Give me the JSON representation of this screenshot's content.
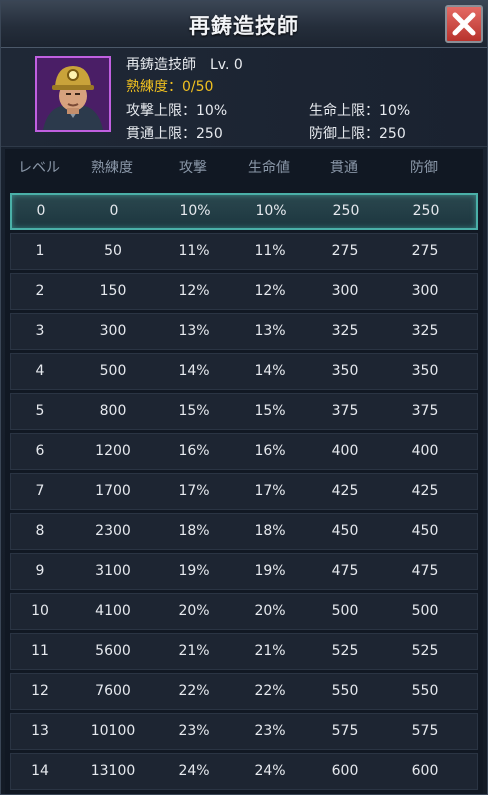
{
  "title": "再鋳造技師",
  "close_icon": "close-icon",
  "character": {
    "name": "再鋳造技師",
    "level": "Lv. 0",
    "proficiency": "熟練度：0/50",
    "stats": {
      "attack_cap": "攻撃上限：10%",
      "hp_cap": "生命上限：10%",
      "pierce_cap": "貫通上限：250",
      "defense_cap": "防御上限：250"
    },
    "avatar_icon": "miner-helmet-portrait-icon"
  },
  "table": {
    "headers": [
      "レベル",
      "熟練度",
      "攻撃",
      "生命値",
      "貫通",
      "防御"
    ],
    "rows": [
      [
        "0",
        "0",
        "10%",
        "10%",
        "250",
        "250"
      ],
      [
        "1",
        "50",
        "11%",
        "11%",
        "275",
        "275"
      ],
      [
        "2",
        "150",
        "12%",
        "12%",
        "300",
        "300"
      ],
      [
        "3",
        "300",
        "13%",
        "13%",
        "325",
        "325"
      ],
      [
        "4",
        "500",
        "14%",
        "14%",
        "350",
        "350"
      ],
      [
        "5",
        "800",
        "15%",
        "15%",
        "375",
        "375"
      ],
      [
        "6",
        "1200",
        "16%",
        "16%",
        "400",
        "400"
      ],
      [
        "7",
        "1700",
        "17%",
        "17%",
        "425",
        "425"
      ],
      [
        "8",
        "2300",
        "18%",
        "18%",
        "450",
        "450"
      ],
      [
        "9",
        "3100",
        "19%",
        "19%",
        "475",
        "475"
      ],
      [
        "10",
        "4100",
        "20%",
        "20%",
        "500",
        "500"
      ],
      [
        "11",
        "5600",
        "21%",
        "21%",
        "525",
        "525"
      ],
      [
        "12",
        "7600",
        "22%",
        "22%",
        "550",
        "550"
      ],
      [
        "13",
        "10100",
        "23%",
        "23%",
        "575",
        "575"
      ],
      [
        "14",
        "13100",
        "24%",
        "24%",
        "600",
        "600"
      ]
    ],
    "current_level_row": 0
  },
  "colors": {
    "accent_gold": "#f0c020",
    "highlight_teal": "#4ab0a8",
    "close_red": "#c9403a",
    "avatar_frame": "#c060e0"
  }
}
